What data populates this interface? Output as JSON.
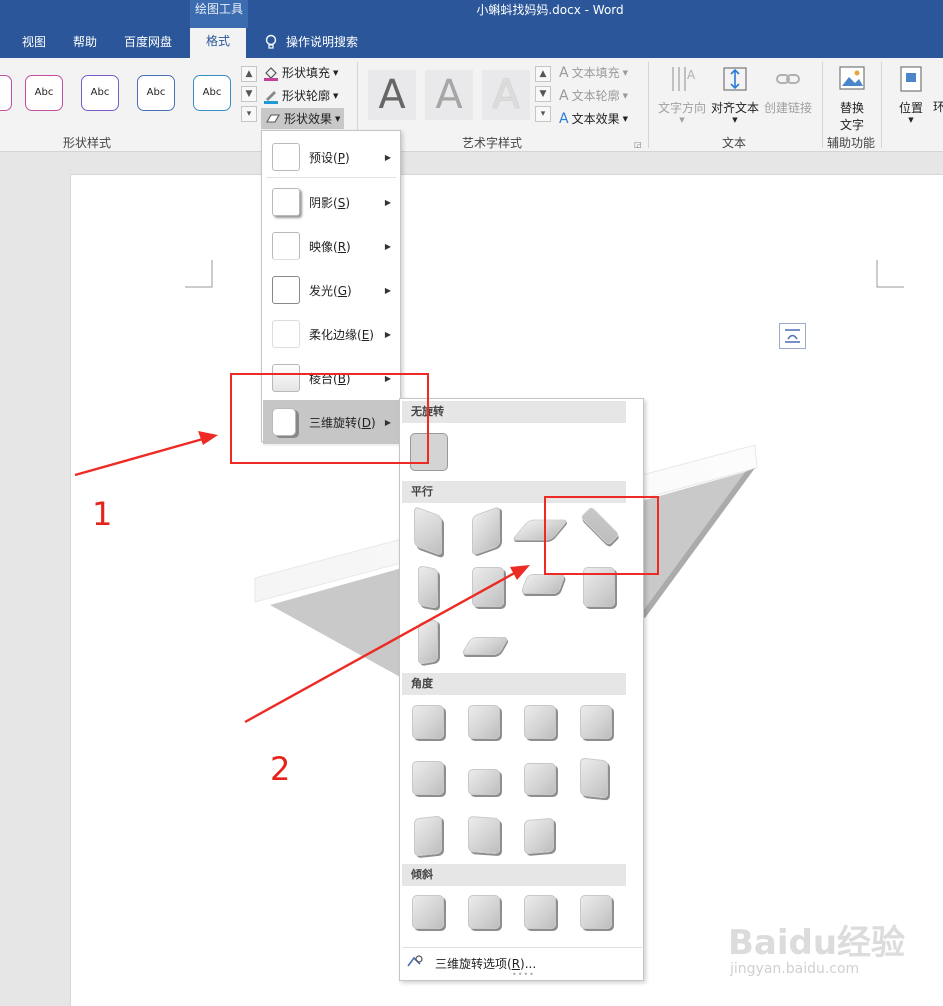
{
  "window": {
    "context_group": "绘图工具",
    "title": "小蝌蚪找妈妈.docx  -  Word"
  },
  "tabs": [
    {
      "label": "视图"
    },
    {
      "label": "帮助"
    },
    {
      "label": "百度网盘"
    },
    {
      "label": "格式",
      "active": true
    }
  ],
  "tell_me": {
    "label": "操作说明搜索",
    "icon": "lightbulb-icon"
  },
  "ribbon": {
    "shape_styles": {
      "label": "形状样式",
      "samples": [
        "Abc",
        "Abc",
        "Abc",
        "Abc"
      ],
      "border_colors": [
        "#c0509f",
        "#7a5cc4",
        "#4a6fb5",
        "#3a8fc2"
      ]
    },
    "shape_commands": [
      {
        "label": "形状填充",
        "icon": "paint-bucket-icon"
      },
      {
        "label": "形状轮廓",
        "icon": "pen-icon"
      },
      {
        "label": "形状效果",
        "icon": "shape-effects-icon"
      }
    ],
    "wordart": {
      "label": "艺术字样式",
      "samples": [
        "A",
        "A",
        "A"
      ],
      "commands": [
        {
          "label": "文本填充"
        },
        {
          "label": "文本轮廓"
        },
        {
          "label": "文本效果"
        }
      ]
    },
    "text_group": {
      "label": "文本",
      "commands": [
        {
          "label": "文字方向"
        },
        {
          "label": "对齐文本"
        },
        {
          "label": "创建链接"
        }
      ]
    },
    "accessibility": {
      "label": "辅助功能",
      "alt_text_line1": "替换",
      "alt_text_line2": "文字"
    },
    "arrange": {
      "position_label": "位置",
      "wrap_partial": "环"
    }
  },
  "effects_menu": {
    "items": [
      {
        "label": "预设(",
        "key": "P",
        "suffix": ")"
      },
      {
        "label": "阴影(",
        "key": "S",
        "suffix": ")"
      },
      {
        "label": "映像(",
        "key": "R",
        "suffix": ")"
      },
      {
        "label": "发光(",
        "key": "G",
        "suffix": ")"
      },
      {
        "label": "柔化边缘(",
        "key": "E",
        "suffix": ")"
      },
      {
        "label": "棱台(",
        "key": "B",
        "suffix": ")"
      },
      {
        "label": "三维旋转(",
        "key": "D",
        "suffix": ")",
        "active": true
      }
    ]
  },
  "rotation_gallery": {
    "sections": [
      {
        "title": "无旋转",
        "count": 1
      },
      {
        "title": "平行",
        "count": 10
      },
      {
        "title": "角度",
        "count": 11
      },
      {
        "title": "倾斜",
        "count": 4
      }
    ],
    "options_label": "三维旋转选项(",
    "options_key": "R",
    "options_suffix": ")..."
  },
  "annotations": {
    "label1": "1",
    "label2": "2",
    "color": "#e5231b"
  },
  "watermark": {
    "brand": "Baidu经验",
    "url": "jingyan.baidu.com"
  }
}
